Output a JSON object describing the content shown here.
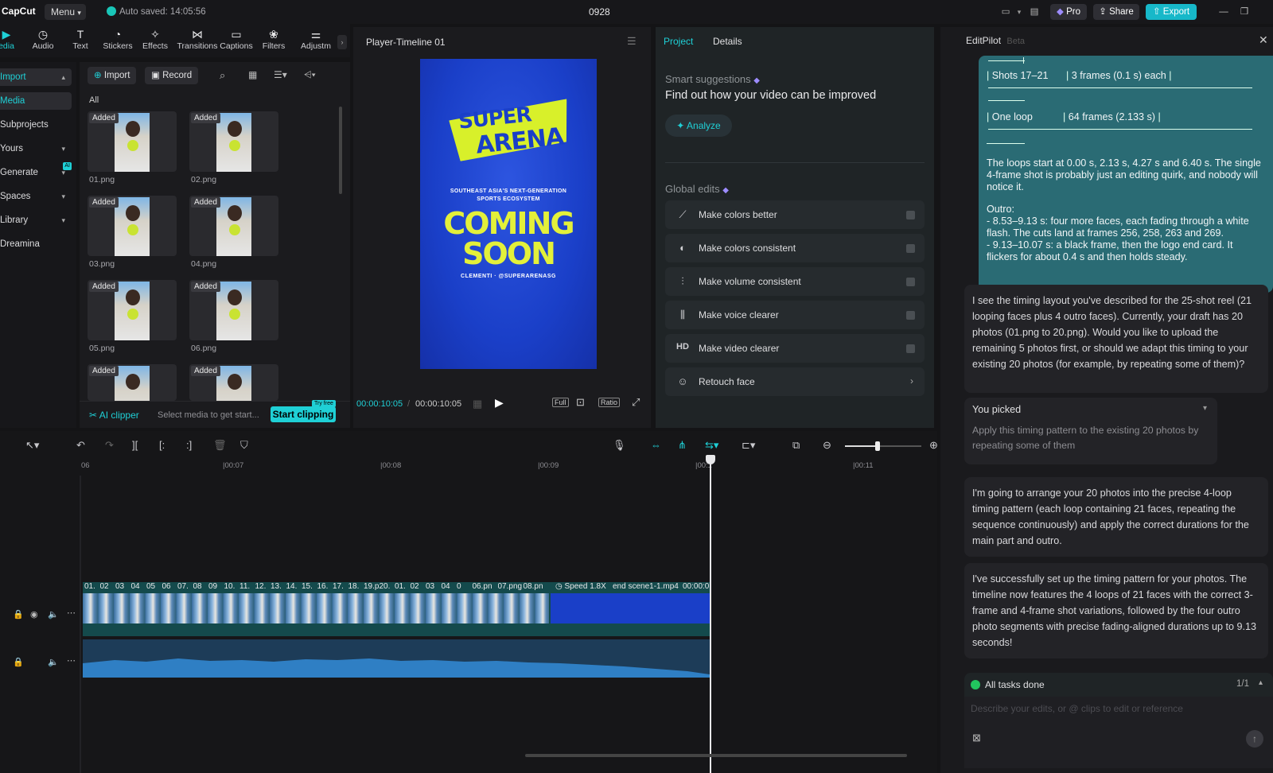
{
  "topbar": {
    "logo": "CapCut",
    "menu": "Menu",
    "autosave": "Auto saved: 14:05:56",
    "project_name": "0928",
    "pro": "Pro",
    "share": "Share",
    "export": "Export"
  },
  "toolbar": {
    "tools": [
      "edia",
      "Audio",
      "Text",
      "Stickers",
      "Effects",
      "Transitions",
      "Captions",
      "Filters",
      "Adjustm"
    ]
  },
  "leftnav": {
    "items": [
      "Import",
      "Media",
      "Subprojects",
      "Yours",
      "Generate",
      "Spaces",
      "Library",
      "Dreamina"
    ],
    "ai_badge": "AI"
  },
  "media": {
    "import_btn": "Import",
    "record_btn": "Record",
    "filter_all": "All",
    "added_badge": "Added",
    "thumbs": [
      "01.png",
      "02.png",
      "03.png",
      "04.png",
      "05.png",
      "06.png"
    ],
    "ai_clipper": "AI clipper",
    "ai_hint": "Select media to get start...",
    "start_clipping": "Start clipping",
    "try_free": "Try free"
  },
  "player": {
    "title": "Player-Timeline 01",
    "current_time": "00:00:10:05",
    "total_time": "00:00:10:05",
    "btn_full": "Full",
    "btn_ratio": "Ratio",
    "poster": {
      "logo_line1": "SUPER",
      "logo_line2": "ARENA",
      "subtitle_line1": "SOUTHEAST ASIA'S NEXT-GENERATION",
      "subtitle_line2": "SPORTS ECOSYSTEM",
      "coming": "COMING",
      "soon": "SOON",
      "handle": "CLEMENTI · @SUPERARENASG"
    }
  },
  "project": {
    "tab_project": "Project",
    "tab_details": "Details",
    "smart_title": "Smart suggestions",
    "smart_text": "Find out how your video can be improved",
    "analyze": "Analyze",
    "global_title": "Global edits",
    "edits": [
      {
        "label": "Make colors better",
        "icon": "magic-wand-icon"
      },
      {
        "label": "Make colors consistent",
        "icon": "palette-icon"
      },
      {
        "label": "Make volume consistent",
        "icon": "sliders-icon"
      },
      {
        "label": "Make voice clearer",
        "icon": "waveform-icon"
      },
      {
        "label": "Make video clearer",
        "icon": "hd-icon"
      },
      {
        "label": "Retouch face",
        "icon": "face-icon"
      }
    ],
    "hd_text": "HD"
  },
  "pilot": {
    "title": "EditPilot",
    "beta": "Beta",
    "table_row1_a": "Shots 17–21",
    "table_row1_b": "3 frames (0.1 s) each",
    "table_row2_a": "One loop",
    "table_row2_b": "64 frames (2.133 s)",
    "user_text1": "The loops start at 0.00 s, 2.13 s, 4.27 s and 6.40 s. The single 4-frame shot is probably just an editing quirk, and nobody will notice it.",
    "user_outro_title": "Outro:",
    "user_outro1": "- 8.53–9.13 s: four more faces, each fading through a white flash. The cuts land at frames 256, 258, 263 and 269.",
    "user_outro2": "- 9.13–10.07 s: a black frame, then the logo end card. It flickers for about 0.4 s and then holds steady.",
    "msg1": "I see the timing layout you've described for the 25-shot reel (21 looping faces plus 4 outro faces). Currently, your draft has 20 photos (01.png to 20.png). Would you like to upload the remaining 5 photos first, or should we adapt this timing to your existing 20 photos (for example, by repeating some of them)?",
    "picked_title": "You picked",
    "picked_text": "Apply this timing pattern to the existing 20 photos by repeating some of them",
    "msg2": "I'm going to arrange your 20 photos into the precise 4-loop timing pattern (each loop containing 21 faces, repeating the sequence continuously) and apply the correct durations for the main part and outro.",
    "msg3": "I've successfully set up the timing pattern for your photos. The timeline now features the 4 loops of 21 faces with the correct 3-frame and 4-frame shot variations, followed by the four outro photo segments with precise fading-aligned durations up to 9.13 seconds!",
    "tasks_done": "All tasks done",
    "tasks_count": "1/1",
    "input_placeholder": "Describe your edits, or @ clips to edit or reference"
  },
  "timeline": {
    "ruler": [
      "06",
      "|00:07",
      "|00:08",
      "|00:09",
      "|00:1",
      "|00:11"
    ],
    "clip_labels": [
      "01.",
      "02",
      "03",
      "04",
      "05",
      "06",
      "07.",
      "08",
      "09",
      "10.",
      "11.",
      "12.",
      "13.",
      "14.",
      "15.",
      "16.",
      "17.",
      "18.",
      "19.p",
      "20.",
      "01.",
      "02",
      "03",
      "04",
      "0",
      "06.pn",
      "07.png",
      "08.pn"
    ],
    "speed": "Speed 1.8X",
    "end_clip": "end scene1-1.mp4",
    "end_time": "00:00:0"
  },
  "colors": {
    "accent": "#1fd0d6",
    "poster_blue": "#1a3fc8",
    "poster_yellow": "#e3f03a",
    "export_btn": "#17b8c9"
  }
}
